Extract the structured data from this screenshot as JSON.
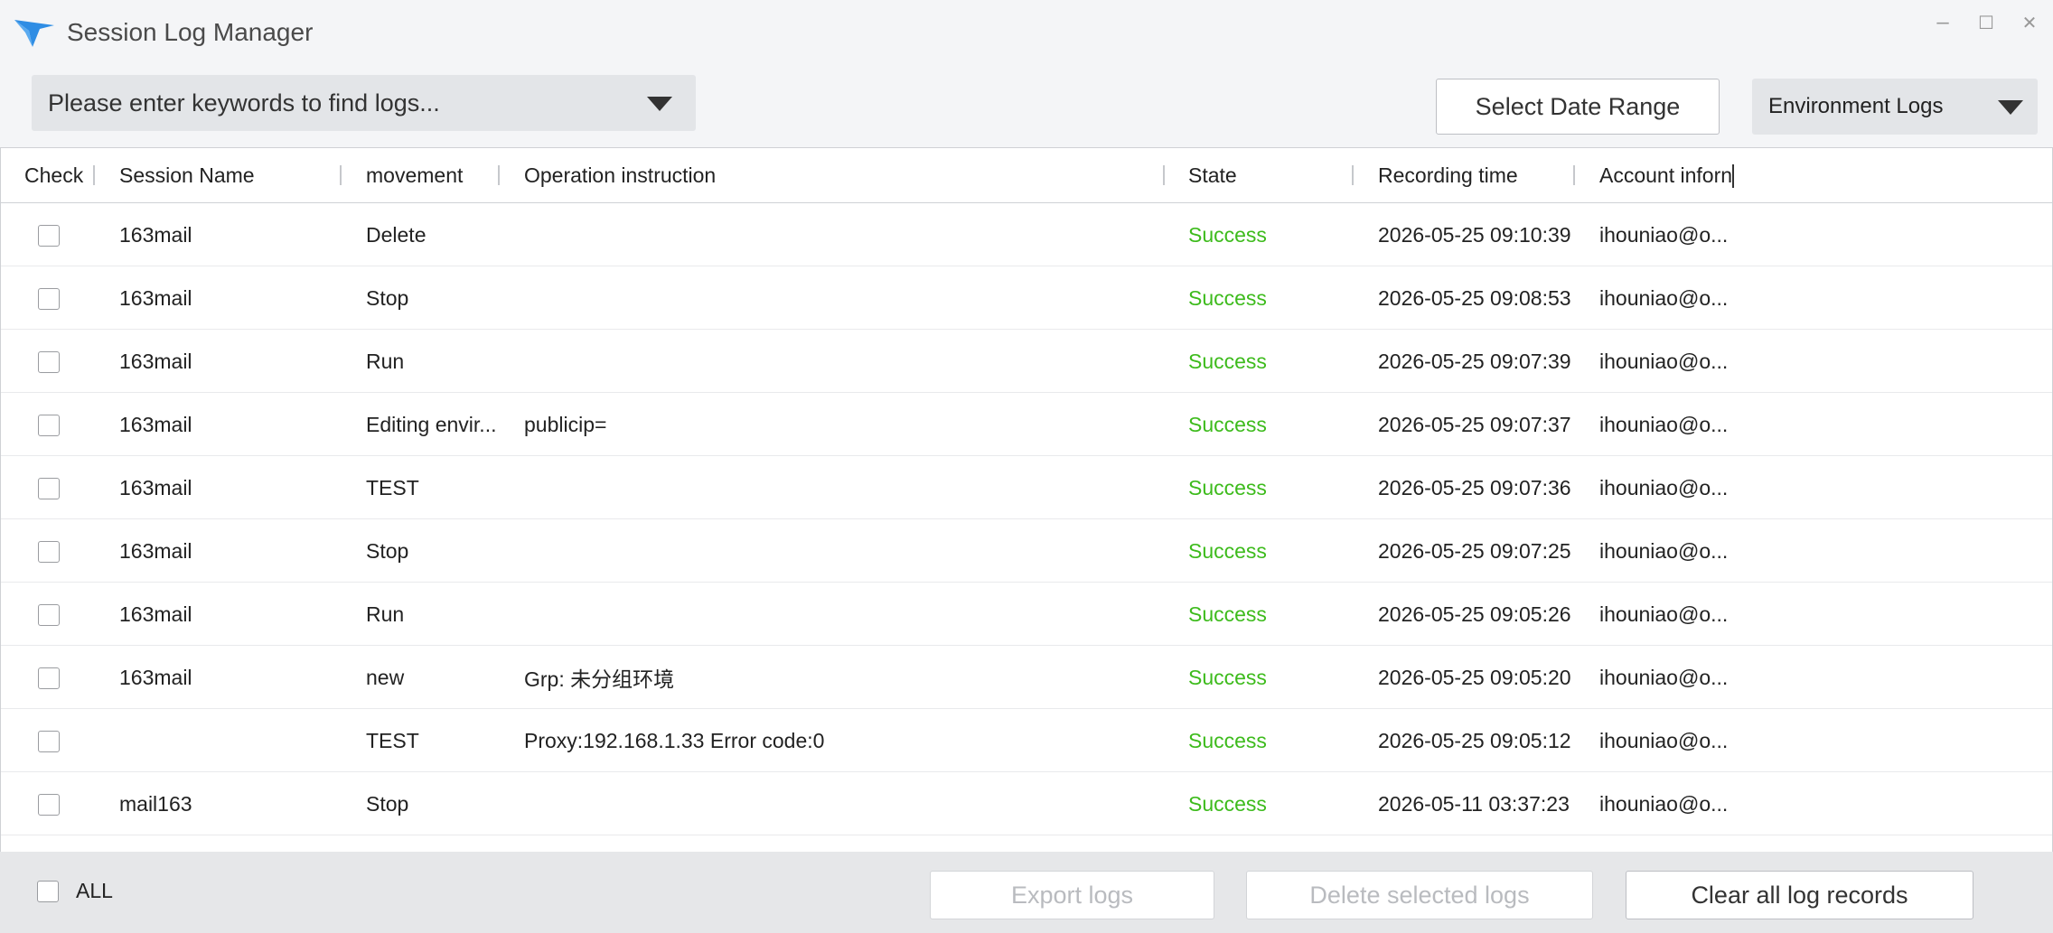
{
  "window": {
    "title": "Session Log Manager",
    "controls": {
      "minimize": "–",
      "maximize": "☐",
      "close": "✕"
    }
  },
  "toolbar": {
    "search_placeholder": "Please enter keywords to find logs...",
    "date_range_label": "Select Date Range",
    "log_type_selected": "Environment Logs"
  },
  "table": {
    "headers": {
      "check": "Check",
      "session_name": "Session Name",
      "movement": "movement",
      "operation": "Operation instruction",
      "state": "State",
      "recording_time": "Recording time",
      "account": "Account inforn"
    },
    "rows": [
      {
        "session": "163mail",
        "movement": "Delete",
        "operation": "",
        "state": "Success",
        "time": "2026-05-25 09:10:39",
        "account": "ihouniao@o..."
      },
      {
        "session": "163mail",
        "movement": "Stop",
        "operation": "",
        "state": "Success",
        "time": "2026-05-25 09:08:53",
        "account": "ihouniao@o..."
      },
      {
        "session": "163mail",
        "movement": "Run",
        "operation": "",
        "state": "Success",
        "time": "2026-05-25 09:07:39",
        "account": "ihouniao@o..."
      },
      {
        "session": "163mail",
        "movement": "Editing envir...",
        "operation": "publicip=",
        "state": "Success",
        "time": "2026-05-25 09:07:37",
        "account": "ihouniao@o..."
      },
      {
        "session": "163mail",
        "movement": "TEST",
        "operation": "",
        "state": "Success",
        "time": "2026-05-25 09:07:36",
        "account": "ihouniao@o..."
      },
      {
        "session": "163mail",
        "movement": "Stop",
        "operation": "",
        "state": "Success",
        "time": "2026-05-25 09:07:25",
        "account": "ihouniao@o..."
      },
      {
        "session": "163mail",
        "movement": "Run",
        "operation": "",
        "state": "Success",
        "time": "2026-05-25 09:05:26",
        "account": "ihouniao@o..."
      },
      {
        "session": "163mail",
        "movement": "new",
        "operation": "Grp: 未分组环境",
        "state": "Success",
        "time": "2026-05-25 09:05:20",
        "account": "ihouniao@o..."
      },
      {
        "session": "",
        "movement": "TEST",
        "operation": "Proxy:192.168.1.33 Error code:0",
        "state": "Success",
        "time": "2026-05-25 09:05:12",
        "account": "ihouniao@o..."
      },
      {
        "session": "mail163",
        "movement": "Stop",
        "operation": "",
        "state": "Success",
        "time": "2026-05-11 03:37:23",
        "account": "ihouniao@o..."
      }
    ]
  },
  "footer": {
    "select_all_label": "ALL",
    "export_label": "Export logs",
    "delete_selected_label": "Delete selected logs",
    "clear_all_label": "Clear all log records"
  },
  "colors": {
    "success": "#3dbb1c",
    "accent_logo": "#2f8de4",
    "background": "#f4f5f7"
  },
  "icons": {
    "logo": "bird-logo-icon",
    "dropdown": "caret-down-icon"
  }
}
